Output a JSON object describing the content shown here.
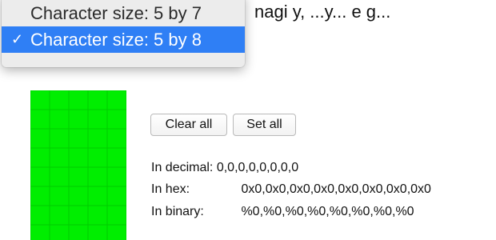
{
  "background": {
    "partial_text": "nagi y, ...y... e g..."
  },
  "dropdown": {
    "options": [
      {
        "label": "Character size: 5 by 7",
        "selected": false
      },
      {
        "label": "Character size: 5 by 8",
        "selected": true
      }
    ],
    "check_glyph": "✓",
    "highlight_color": "#2f7ff5"
  },
  "grid": {
    "columns": 5,
    "rows": 8,
    "fill_color": "#00ee00"
  },
  "buttons": {
    "clear_all": "Clear all",
    "set_all": "Set all"
  },
  "output": {
    "decimal_label": "In decimal:",
    "decimal_value": "0,0,0,0,0,0,0,0",
    "hex_label": "In hex:",
    "hex_value": "0x0,0x0,0x0,0x0,0x0,0x0,0x0,0x0",
    "binary_label": "In binary:",
    "binary_value": "%0,%0,%0,%0,%0,%0,%0,%0"
  }
}
